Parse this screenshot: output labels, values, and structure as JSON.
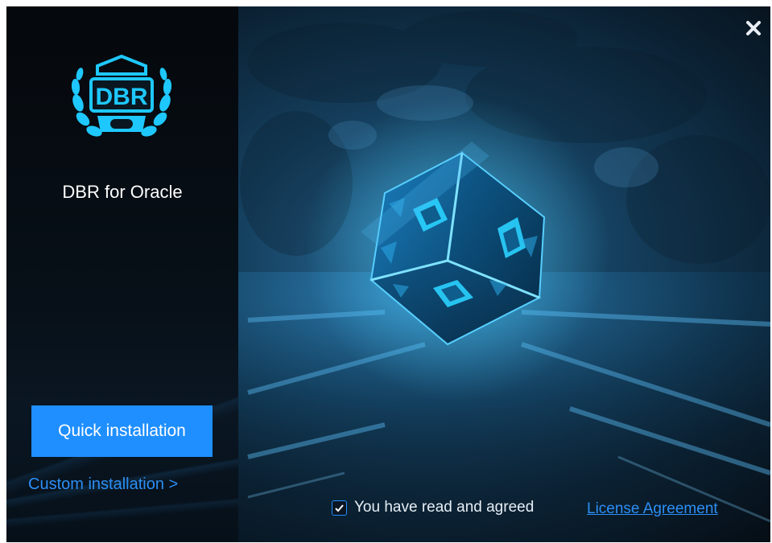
{
  "app": {
    "logo_text": "DBR",
    "product_title": "DBR for Oracle"
  },
  "actions": {
    "quick_install_label": "Quick installation",
    "custom_install_label": "Custom installation >"
  },
  "agreement": {
    "checked": true,
    "text": "You have read and agreed",
    "link_label": "License Agreement"
  },
  "icons": {
    "close": "close-icon",
    "check": "check-icon",
    "logo": "dbr-logo"
  },
  "colors": {
    "accent": "#1f8fff",
    "link": "#2c8ff5",
    "left_panel": "#060a10",
    "cube_glow": "#1ec8ff"
  }
}
